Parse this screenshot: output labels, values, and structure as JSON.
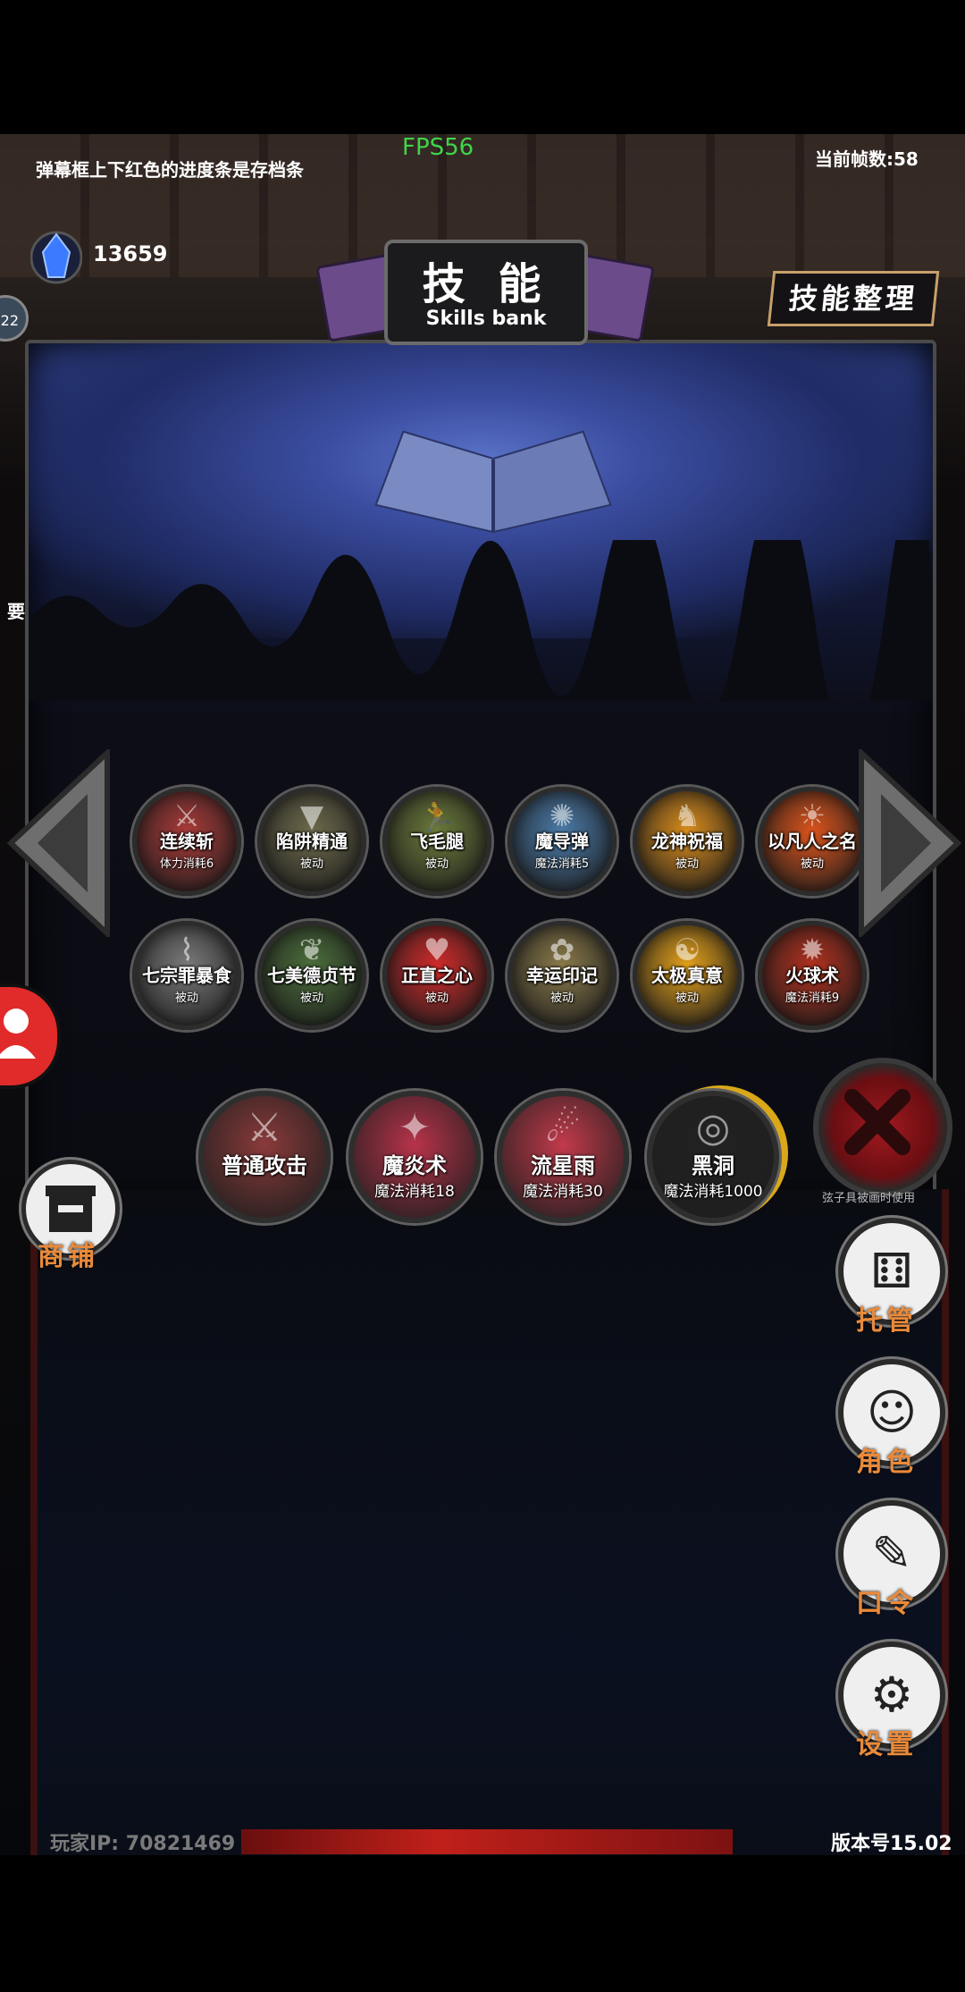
{
  "top": {
    "fps": "FPS56",
    "hint": "弹幕框上下红色的进度条是存档条",
    "frame_count": "当前帧数:58",
    "gem_count": "13659",
    "left_badge": "22",
    "left_partial": "要"
  },
  "panel": {
    "title_cn": "技 能",
    "title_en": "Skills bank",
    "organize_button": "技能整理"
  },
  "skills_row1": [
    {
      "name": "连续斩",
      "sub": "体力消耗6",
      "color": "#a83a38",
      "icon": "sword-icon"
    },
    {
      "name": "陷阱精通",
      "sub": "被动",
      "color": "#6e6a4c",
      "icon": "trap-icon"
    },
    {
      "name": "飞毛腿",
      "sub": "被动",
      "color": "#6b7a3a",
      "icon": "runner-icon"
    },
    {
      "name": "魔导弹",
      "sub": "魔法消耗5",
      "color": "#4a7aa8",
      "icon": "magic-orb-icon"
    },
    {
      "name": "龙神祝福",
      "sub": "被动",
      "color": "#d98c1c",
      "icon": "dragon-icon"
    },
    {
      "name": "以凡人之名",
      "sub": "被动",
      "color": "#d9531c",
      "icon": "human-icon"
    }
  ],
  "skills_row2": [
    {
      "name": "七宗罪暴食",
      "sub": "被动",
      "color": "#7a7a7a",
      "icon": "claw-icon"
    },
    {
      "name": "七美德贞节",
      "sub": "被动",
      "color": "#4b6e3a",
      "icon": "leaf-icon"
    },
    {
      "name": "正直之心",
      "sub": "被动",
      "color": "#cf2a2a",
      "icon": "heart-icon"
    },
    {
      "name": "幸运印记",
      "sub": "被动",
      "color": "#8a7a4a",
      "icon": "shrimp-icon"
    },
    {
      "name": "太极真意",
      "sub": "被动",
      "color": "#e3a01a",
      "icon": "taiji-icon"
    },
    {
      "name": "火球术",
      "sub": "魔法消耗9",
      "color": "#b0301e",
      "icon": "fireball-icon"
    }
  ],
  "equipped": [
    {
      "name": "普通攻击",
      "sub": "",
      "color": "#8a3a3a",
      "icon": "sword-icon"
    },
    {
      "name": "魔炎术",
      "sub": "魔法消耗18",
      "color": "#b8334a",
      "icon": "flame-icon"
    },
    {
      "name": "流星雨",
      "sub": "魔法消耗30",
      "color": "#c23a4a",
      "icon": "meteor-icon"
    },
    {
      "name": "黑洞",
      "sub": "魔法消耗1000",
      "color": "#222222",
      "icon": "black-hole-icon"
    }
  ],
  "close_hint": "弦子具被画时使用",
  "side_menu": [
    {
      "label": "托管",
      "icon": "dice-icon",
      "glyph": "⚅"
    },
    {
      "label": "角色",
      "icon": "character-icon",
      "glyph": "☺"
    },
    {
      "label": "口令",
      "icon": "book-icon",
      "glyph": "✎"
    },
    {
      "label": "设置",
      "icon": "gear-icon",
      "glyph": "⚙"
    }
  ],
  "shop": {
    "label": "商铺"
  },
  "footer": {
    "player_ip": "玩家IP:  70821469",
    "version": "版本号15.02"
  }
}
